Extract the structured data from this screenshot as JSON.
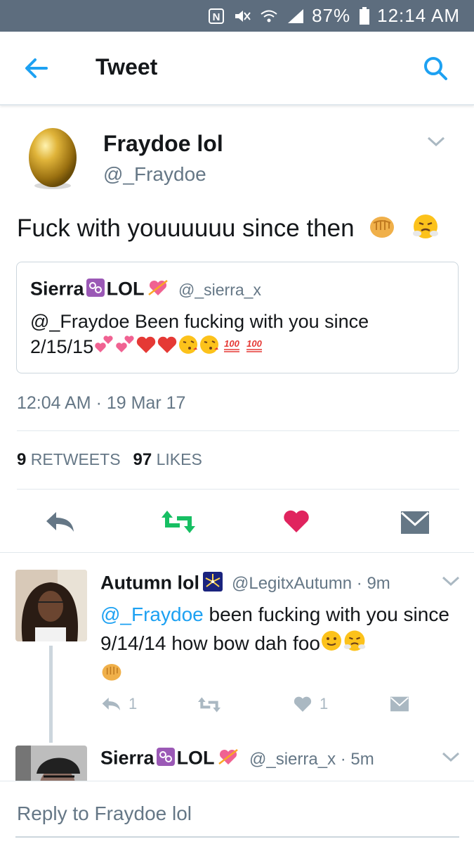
{
  "status_bar": {
    "battery": "87%",
    "time": "12:14 AM"
  },
  "appbar": {
    "title": "Tweet"
  },
  "tweet": {
    "name": "Fraydoe lol",
    "handle": "@_Fraydoe",
    "text": "Fuck with youuuuuu since then",
    "timestamp": "12:04 AM · 19 Mar 17",
    "retweets_count": "9",
    "retweets_label": "RETWEETS",
    "likes_count": "97",
    "likes_label": "LIKES"
  },
  "quote": {
    "name_a": "Sierra",
    "name_b": "LOL",
    "handle": "@_sierra_x",
    "text_line1": "@_Fraydoe Been fucking with you since",
    "text_date": "2/15/15"
  },
  "replies": [
    {
      "name": "Autumn lol",
      "handle": "@LegitxAutumn",
      "time": "· 9m",
      "mention": "@_Fraydoe",
      "text": " been fucking with you since 9/14/14 how bow dah foo",
      "reply_count": "1",
      "like_count": "1"
    },
    {
      "name_a": "Sierra",
      "name_b": "LOL",
      "handle": "@_sierra_x",
      "time": "· 5m"
    }
  ],
  "reply_bar": {
    "placeholder": "Reply to Fraydoe lol"
  },
  "colors": {
    "accent": "#1da1f2",
    "retweet": "#17bf63",
    "like": "#e0245e",
    "muted": "#657786"
  }
}
